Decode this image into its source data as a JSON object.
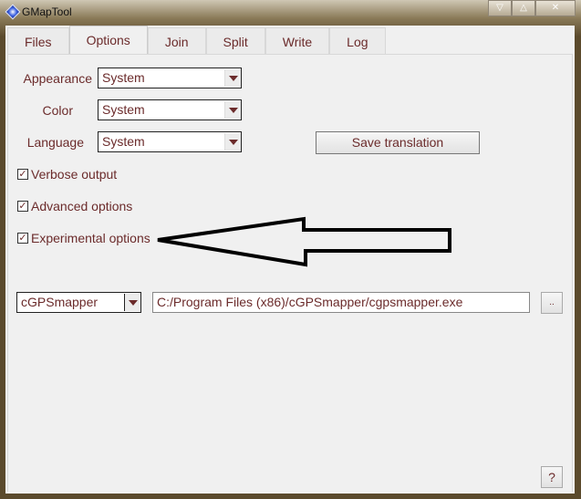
{
  "window": {
    "title": "GMapTool",
    "icon": "diamond-icon"
  },
  "tabs": [
    {
      "label": "Files"
    },
    {
      "label": "Options",
      "active": true
    },
    {
      "label": "Join"
    },
    {
      "label": "Split"
    },
    {
      "label": "Write"
    },
    {
      "label": "Log"
    }
  ],
  "options": {
    "appearance": {
      "label": "Appearance",
      "value": "System"
    },
    "color": {
      "label": "Color",
      "value": "System"
    },
    "language": {
      "label": "Language",
      "value": "System"
    },
    "save_translation": "Save translation",
    "verbose": {
      "label": "Verbose output",
      "checked": true
    },
    "advanced": {
      "label": "Advanced options",
      "checked": true
    },
    "experimental": {
      "label": "Experimental options",
      "checked": true
    },
    "mapper": {
      "value": "cGPSmapper"
    },
    "mapper_path": "C:/Program Files (x86)/cGPSmapper/cgpsmapper.exe",
    "browse": "..",
    "help": "?"
  },
  "colors": {
    "text": "#6b2b2b",
    "arrow": "#000000"
  }
}
